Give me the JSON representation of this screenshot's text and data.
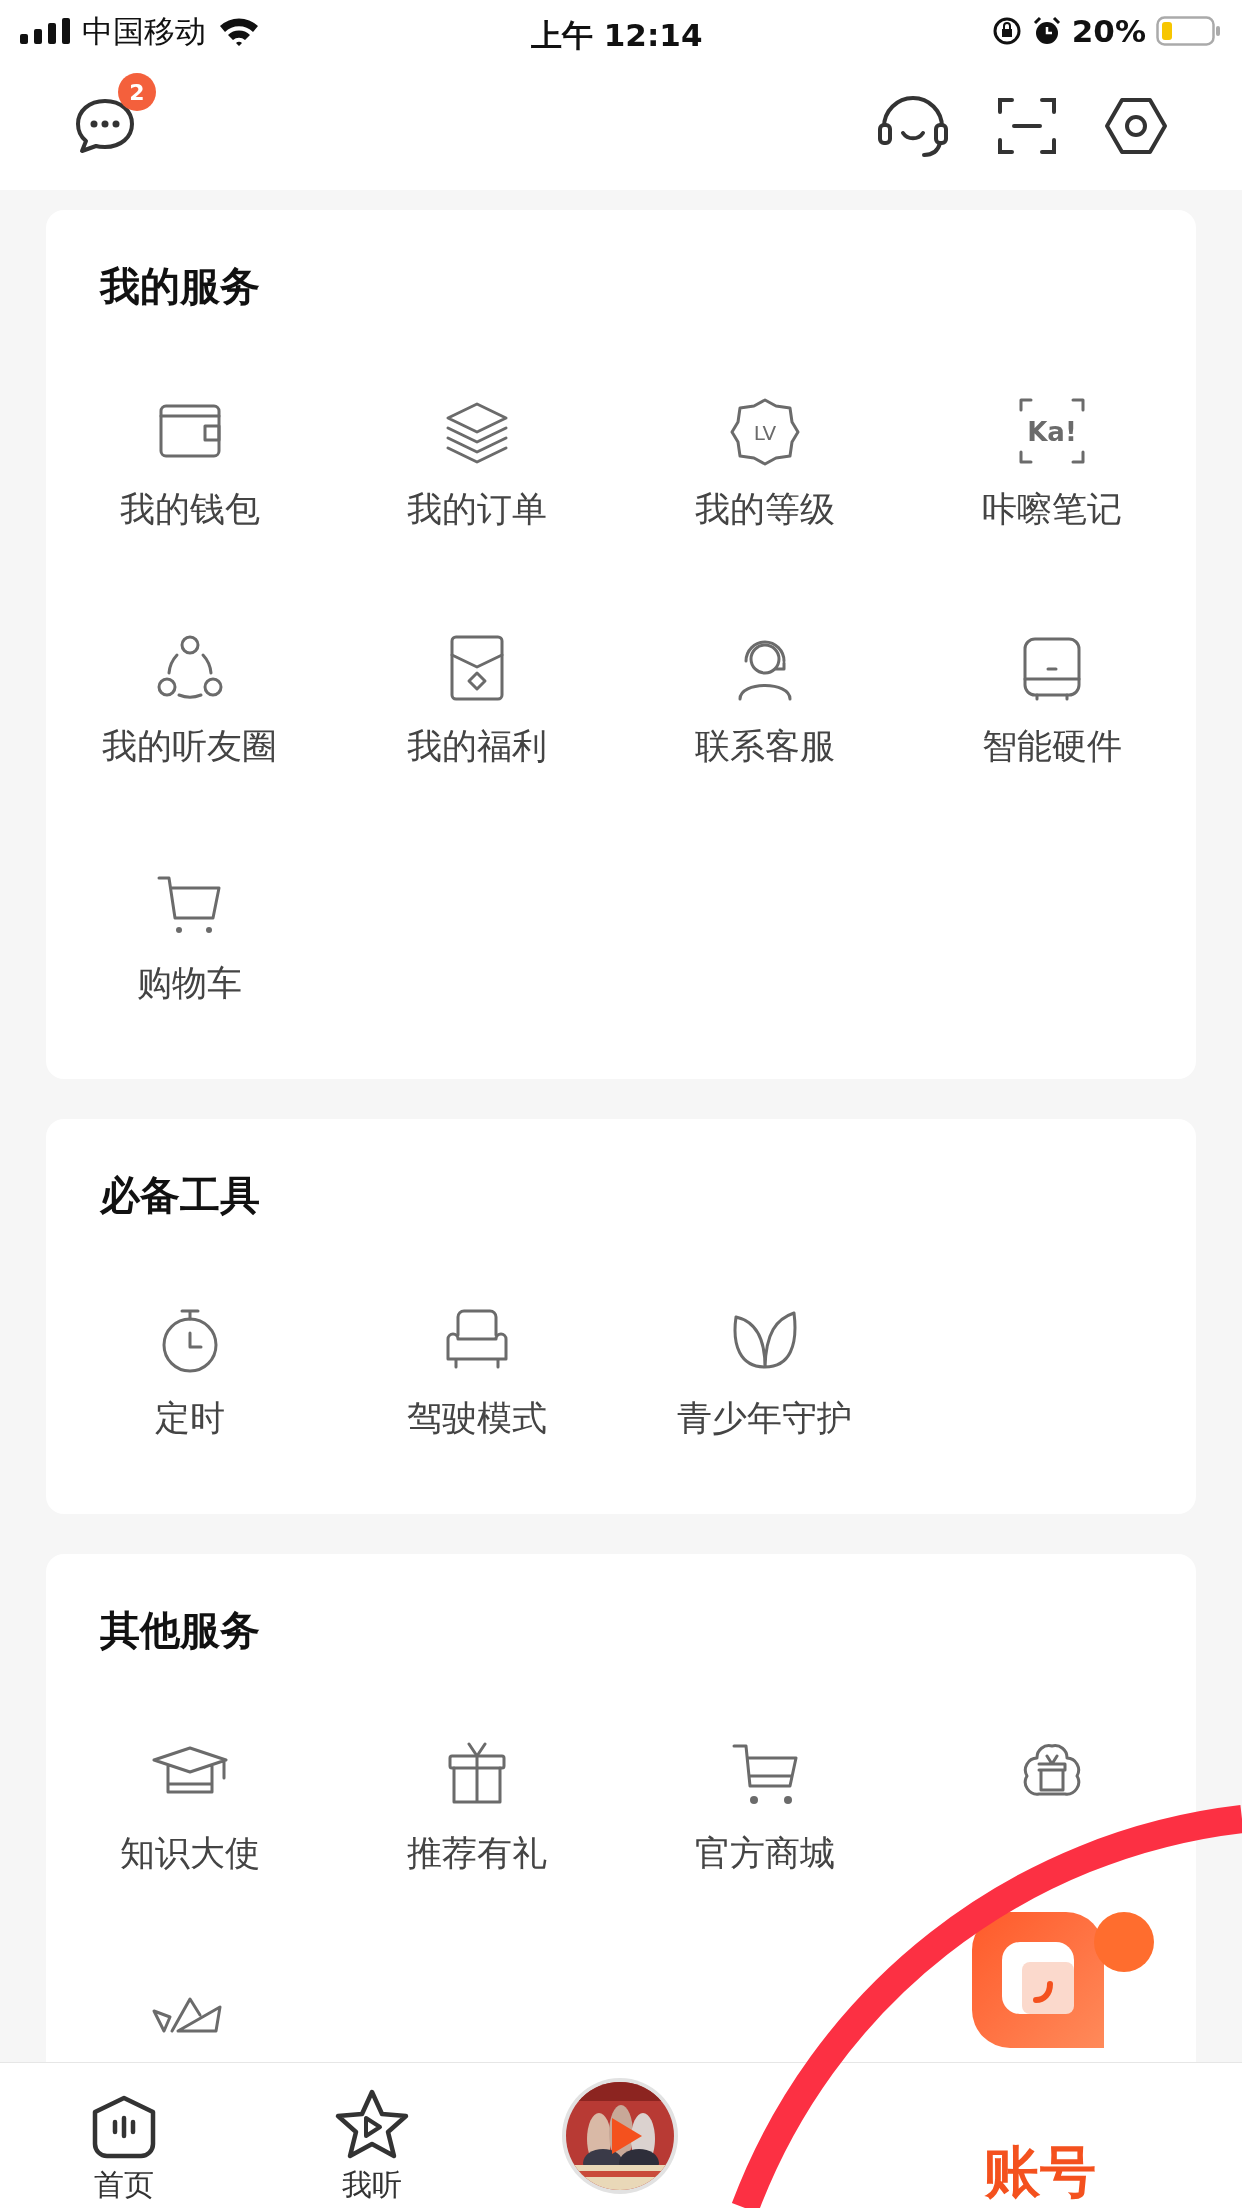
{
  "status_bar": {
    "carrier": "中国移动",
    "time": "上午 12:14",
    "battery": "20%"
  },
  "header": {
    "message_badge": "2"
  },
  "sections": [
    {
      "title": "我的服务",
      "items": [
        {
          "kind": "labeled",
          "label": "我的钱包"
        },
        {
          "kind": "labeled",
          "label": "我的订单"
        },
        {
          "kind": "labeled",
          "label": "我的等级",
          "icon_text": "LV"
        },
        {
          "kind": "labeled",
          "label": "咔嚓笔记",
          "icon_text": "Ka!"
        },
        {
          "kind": "labeled",
          "label": "我的听友圈"
        },
        {
          "kind": "labeled",
          "label": "我的福利"
        },
        {
          "kind": "labeled",
          "label": "联系客服"
        },
        {
          "kind": "labeled",
          "label": "智能硬件"
        },
        {
          "kind": "labeled",
          "label": "购物车"
        }
      ]
    },
    {
      "title": "必备工具",
      "items": [
        {
          "kind": "labeled",
          "label": "定时"
        },
        {
          "kind": "labeled",
          "label": "驾驶模式"
        },
        {
          "kind": "labeled",
          "label": "青少年守护"
        }
      ]
    },
    {
      "title": "其他服务",
      "items": [
        {
          "kind": "labeled",
          "label": "知识大使"
        },
        {
          "kind": "labeled",
          "label": "推荐有礼"
        },
        {
          "kind": "labeled",
          "label": "官方商城"
        },
        {
          "kind": "icon_only"
        },
        {
          "kind": "icon_only"
        }
      ]
    }
  ],
  "tab_bar": [
    {
      "kind": "tab",
      "label": "首页",
      "selected": false
    },
    {
      "kind": "tab",
      "label": "我听",
      "selected": false
    },
    {
      "kind": "player"
    },
    {
      "kind": "tab",
      "label": "账号",
      "selected": true
    }
  ]
}
